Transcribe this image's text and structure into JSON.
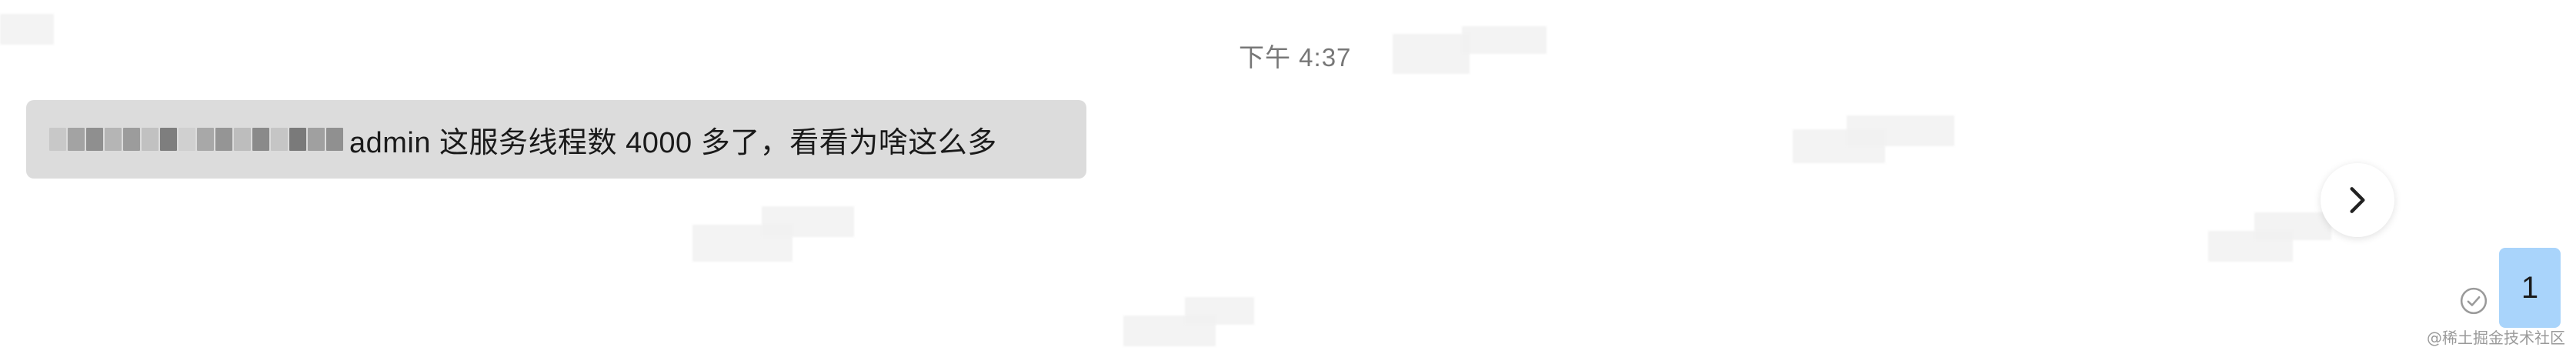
{
  "chat": {
    "timestamp": "下午 4:37",
    "incoming_message": {
      "text": "admin 这服务线程数 4000 多了，看看为啥这么多",
      "bubble_color": "#dcdcdc"
    },
    "outgoing_message": {
      "text": "1",
      "bubble_color": "#a9d4fb"
    },
    "scroll_button_icon": "chevron-right-icon",
    "read_status_icon": "check-circle-icon"
  },
  "watermark": "@稀土掘金技术社区"
}
